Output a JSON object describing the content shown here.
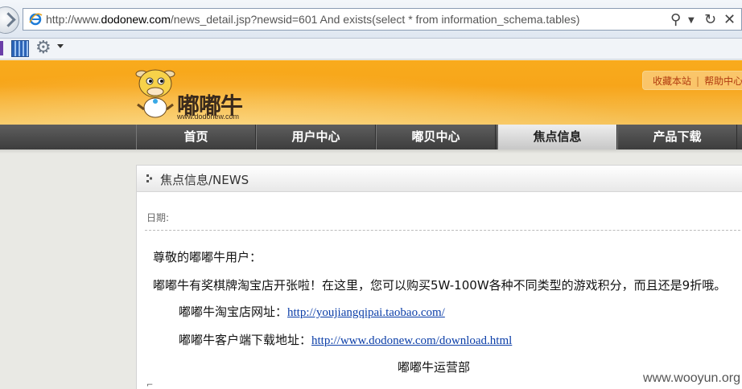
{
  "browser": {
    "url_prefix": "http://www.",
    "url_domain": "dodonew.com",
    "url_rest": "/news_detail.jsp?newsid=601 And exists(select * from information_schema.tables)"
  },
  "site": {
    "logo_text": "嘟嘟牛",
    "logo_url": "www.dodonew.com",
    "top_links": [
      "收藏本站",
      "帮助中心"
    ]
  },
  "nav": {
    "items": [
      "首页",
      "用户中心",
      "嘟贝中心",
      "焦点信息",
      "产品下载"
    ],
    "active": "焦点信息"
  },
  "article": {
    "panel_title": "焦点信息/NEWS",
    "date_label": "日期:",
    "greeting": "尊敬的嘟嘟牛用户：",
    "body_line": "嘟嘟牛有奖棋牌淘宝店开张啦！在这里，您可以购买5W-100W各种不同类型的游戏积分，而且还是9折哦。",
    "shop_label": "嘟嘟牛淘宝店网址：",
    "shop_url": "http://youjiangqipai.taobao.com/",
    "download_label": "嘟嘟牛客户端下载地址：",
    "download_url": "http://www.dodonew.com/download.html",
    "signature": "嘟嘟牛运营部"
  },
  "watermark": "www.wooyun.org",
  "colors": {
    "header_orange": "#f7a51a",
    "nav_dark": "#4a4a4a",
    "link_blue": "#0b3ea8"
  }
}
